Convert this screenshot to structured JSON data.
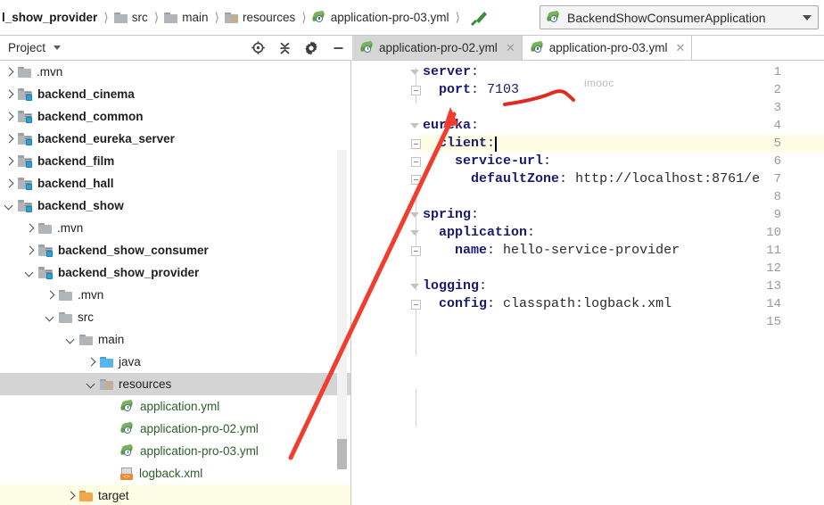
{
  "breadcrumb": {
    "items": [
      {
        "label": "l_show_provider",
        "icon": "none",
        "bold": true
      },
      {
        "label": "src",
        "icon": "folder-icon",
        "bold": false
      },
      {
        "label": "main",
        "icon": "folder-icon",
        "bold": false
      },
      {
        "label": "resources",
        "icon": "resources-folder-icon",
        "bold": false
      },
      {
        "label": "application-pro-03.yml",
        "icon": "yml-file-icon",
        "bold": false
      }
    ],
    "build_icon": "hammer-icon"
  },
  "run_config": {
    "icon": "spring-boot-icon",
    "name": "BackendShowConsumerApplication",
    "dropdown_icon": "chevron-down-icon"
  },
  "project_panel": {
    "title": "Project",
    "dropdown_icon": "chevron-down-icon",
    "tools": [
      {
        "name": "locate-icon",
        "label": "Select Opened File"
      },
      {
        "name": "collapse-all-icon",
        "label": "Collapse All"
      },
      {
        "name": "gear-icon",
        "label": "Settings"
      },
      {
        "name": "minimize-icon",
        "label": "Hide"
      }
    ]
  },
  "editor_tabs": [
    {
      "label": "application-pro-02.yml",
      "icon": "yml-file-icon",
      "active": true,
      "close_icon": "close-icon"
    },
    {
      "label": "application-pro-03.yml",
      "icon": "yml-file-icon",
      "active": false,
      "close_icon": "close-icon"
    }
  ],
  "tree": [
    {
      "label": ".mvn",
      "indent": 0,
      "toggle": "right",
      "icon": "folder-icon",
      "bold": false,
      "state": "none"
    },
    {
      "label": "backend_cinema",
      "indent": 0,
      "toggle": "right",
      "icon": "module-folder-icon",
      "bold": true,
      "state": "none"
    },
    {
      "label": "backend_common",
      "indent": 0,
      "toggle": "right",
      "icon": "module-folder-icon",
      "bold": true,
      "state": "none"
    },
    {
      "label": "backend_eureka_server",
      "indent": 0,
      "toggle": "right",
      "icon": "module-folder-icon",
      "bold": true,
      "state": "none"
    },
    {
      "label": "backend_film",
      "indent": 0,
      "toggle": "right",
      "icon": "module-folder-icon",
      "bold": true,
      "state": "none"
    },
    {
      "label": "backend_hall",
      "indent": 0,
      "toggle": "right",
      "icon": "module-folder-icon",
      "bold": true,
      "state": "none"
    },
    {
      "label": "backend_show",
      "indent": 0,
      "toggle": "down",
      "icon": "module-folder-icon",
      "bold": true,
      "state": "none"
    },
    {
      "label": ".mvn",
      "indent": 1,
      "toggle": "right",
      "icon": "folder-icon",
      "bold": false,
      "state": "none"
    },
    {
      "label": "backend_show_consumer",
      "indent": 1,
      "toggle": "right",
      "icon": "module-folder-icon",
      "bold": true,
      "state": "none"
    },
    {
      "label": "backend_show_provider",
      "indent": 1,
      "toggle": "down",
      "icon": "module-folder-icon",
      "bold": true,
      "state": "none"
    },
    {
      "label": ".mvn",
      "indent": 2,
      "toggle": "right",
      "icon": "folder-icon",
      "bold": false,
      "state": "none"
    },
    {
      "label": "src",
      "indent": 2,
      "toggle": "down",
      "icon": "folder-icon",
      "bold": false,
      "state": "none"
    },
    {
      "label": "main",
      "indent": 3,
      "toggle": "down",
      "icon": "folder-icon",
      "bold": false,
      "state": "none"
    },
    {
      "label": "java",
      "indent": 4,
      "toggle": "right",
      "icon": "source-folder-icon",
      "bold": false,
      "state": "none"
    },
    {
      "label": "resources",
      "indent": 4,
      "toggle": "down",
      "icon": "resources-folder-icon",
      "bold": false,
      "state": "selected"
    },
    {
      "label": "application.yml",
      "indent": 5,
      "toggle": "none",
      "icon": "yml-file-icon",
      "bold": false,
      "state": "none"
    },
    {
      "label": "application-pro-02.yml",
      "indent": 5,
      "toggle": "none",
      "icon": "yml-file-icon",
      "bold": false,
      "state": "none"
    },
    {
      "label": "application-pro-03.yml",
      "indent": 5,
      "toggle": "none",
      "icon": "yml-file-icon",
      "bold": false,
      "state": "none"
    },
    {
      "label": "logback.xml",
      "indent": 5,
      "toggle": "none",
      "icon": "xml-file-icon",
      "bold": false,
      "state": "none"
    },
    {
      "label": "target",
      "indent": 3,
      "toggle": "right",
      "icon": "target-folder-icon",
      "bold": false,
      "state": "highlight"
    }
  ],
  "code": {
    "lines": [
      {
        "n": "1",
        "indent": 0,
        "key": "server",
        "sep": ":",
        "value": "",
        "value_type": "none",
        "fold": "tri"
      },
      {
        "n": "2",
        "indent": 1,
        "key": "port",
        "sep": ":",
        "value": "7103",
        "value_type": "number",
        "fold": "box"
      },
      {
        "n": "3",
        "indent": 0,
        "key": "",
        "sep": "",
        "value": "",
        "value_type": "none",
        "fold": "none"
      },
      {
        "n": "4",
        "indent": 0,
        "key": "eureka",
        "sep": ":",
        "value": "",
        "value_type": "none",
        "fold": "tri"
      },
      {
        "n": "5",
        "indent": 1,
        "key": "client",
        "sep": ":",
        "value": "",
        "value_type": "none",
        "fold": "box"
      },
      {
        "n": "6",
        "indent": 2,
        "key": "service-url",
        "sep": ":",
        "value": "",
        "value_type": "none",
        "fold": "box"
      },
      {
        "n": "7",
        "indent": 3,
        "key": "defaultZone",
        "sep": ":",
        "value": "http://localhost:8761/e",
        "value_type": "plain",
        "fold": "box"
      },
      {
        "n": "8",
        "indent": 0,
        "key": "",
        "sep": "",
        "value": "",
        "value_type": "none",
        "fold": "none"
      },
      {
        "n": "9",
        "indent": 0,
        "key": "spring",
        "sep": ":",
        "value": "",
        "value_type": "none",
        "fold": "tri"
      },
      {
        "n": "10",
        "indent": 1,
        "key": "application",
        "sep": ":",
        "value": "",
        "value_type": "none",
        "fold": "tri"
      },
      {
        "n": "11",
        "indent": 2,
        "key": "name",
        "sep": ":",
        "value": "hello-service-provider",
        "value_type": "plain",
        "fold": "box"
      },
      {
        "n": "12",
        "indent": 0,
        "key": "",
        "sep": "",
        "value": "",
        "value_type": "none",
        "fold": "none"
      },
      {
        "n": "13",
        "indent": 0,
        "key": "logging",
        "sep": ":",
        "value": "",
        "value_type": "none",
        "fold": "tri"
      },
      {
        "n": "14",
        "indent": 1,
        "key": "config",
        "sep": ":",
        "value": "classpath:logback.xml",
        "value_type": "plain",
        "fold": "box"
      },
      {
        "n": "15",
        "indent": 0,
        "key": "",
        "sep": "",
        "value": "",
        "value_type": "none",
        "fold": "none"
      }
    ],
    "caret_line": 5
  },
  "watermark": "imooc",
  "annotations": {
    "arrow_color": "#f03d2e",
    "underline_color": "#e02b20",
    "arrow_from": "application-pro-03.yml",
    "arrow_to": "port: 7103"
  },
  "colors": {
    "key": "#1a1a6e",
    "selection": "#d4d4d4",
    "caret_line": "#fdfce4",
    "tab_active": "#d6d6d6",
    "border": "#c9c9c9"
  }
}
